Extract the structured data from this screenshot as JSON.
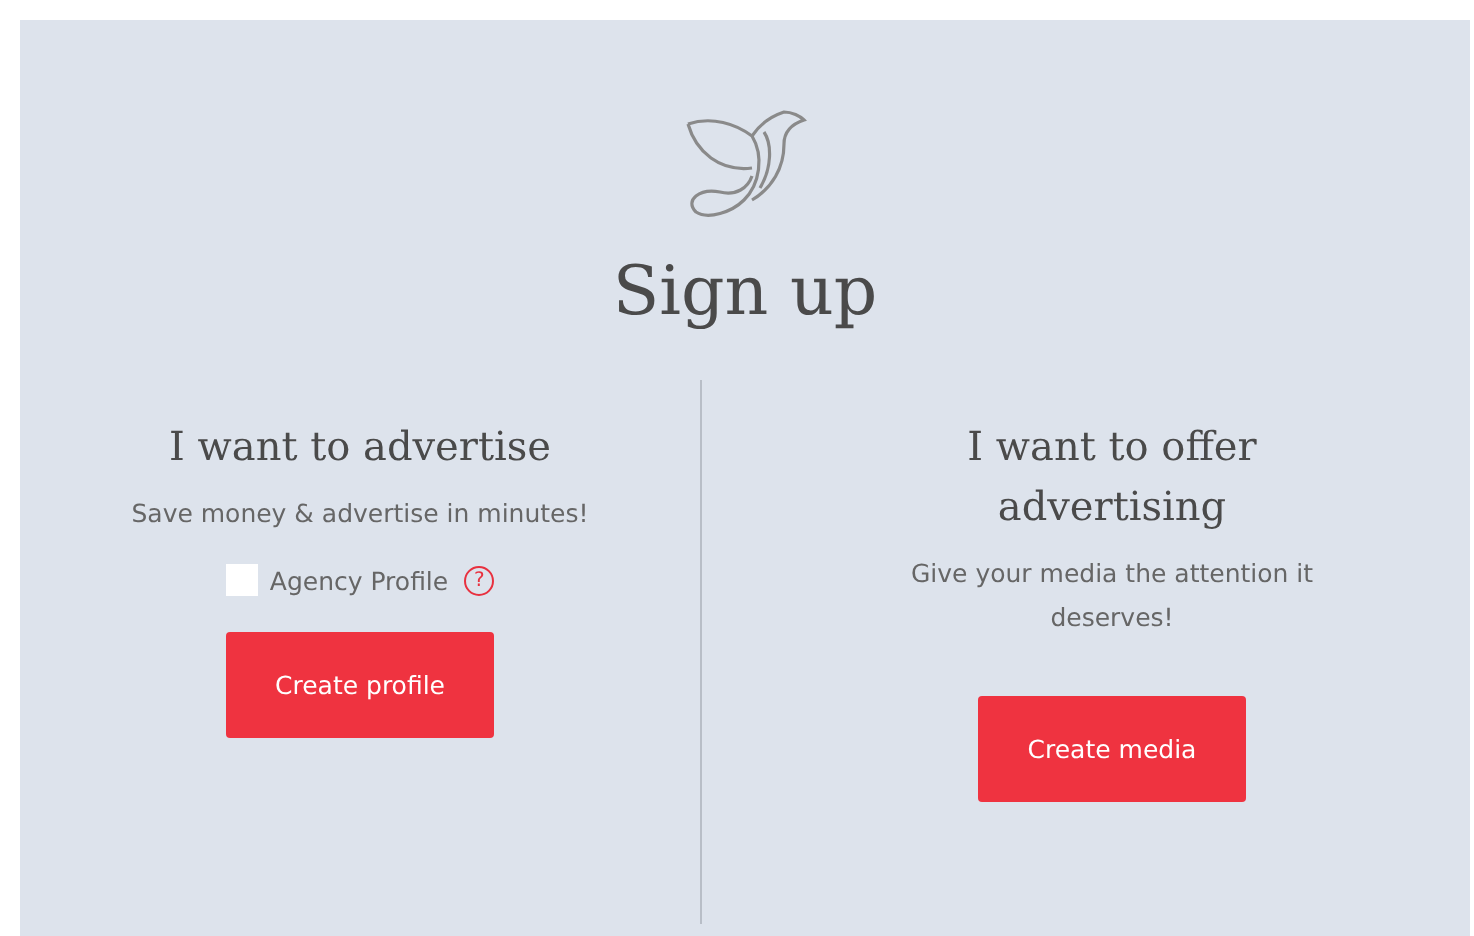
{
  "title": "Sign up",
  "columns": [
    {
      "kind": "advertiser",
      "heading": "I want to advertise",
      "description": "Save money & advertise in minutes!",
      "checkbox": {
        "label": "Agency Profile",
        "checked": false,
        "help": "?"
      },
      "button": "Create profile"
    },
    {
      "kind": "publisher",
      "heading": "I want to offer advertising",
      "description": "Give your media the attention it deserves!",
      "button": "Create media"
    }
  ]
}
